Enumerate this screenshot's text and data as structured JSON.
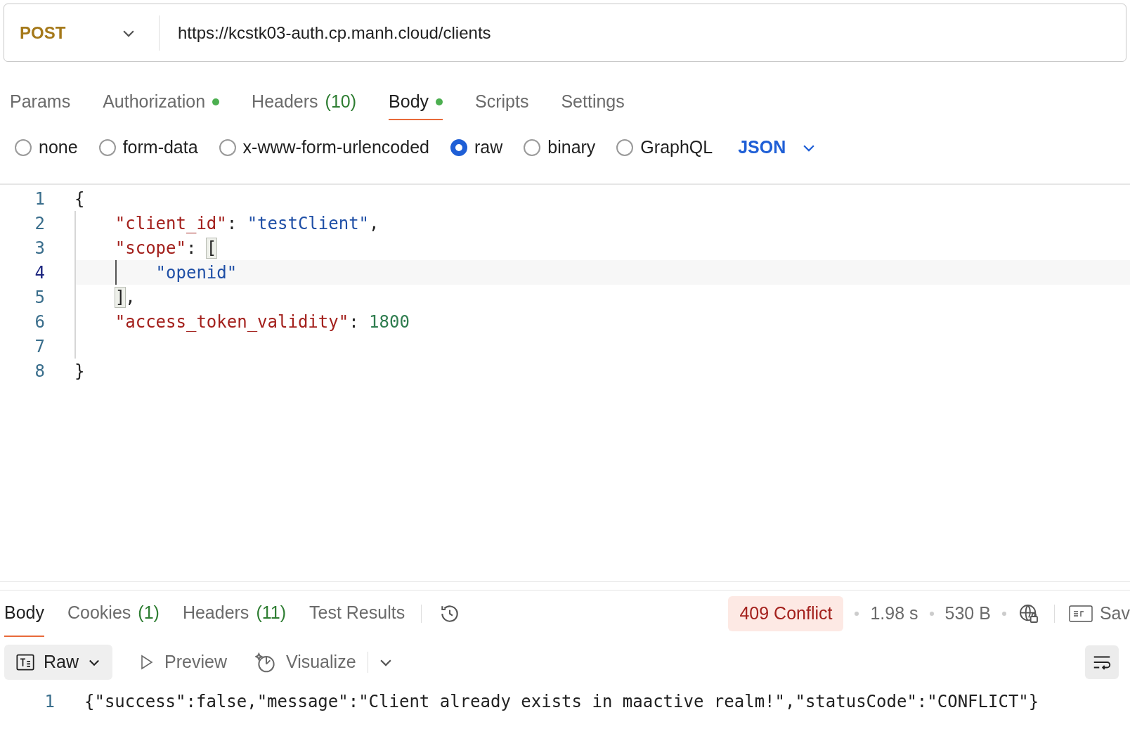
{
  "request": {
    "method": "POST",
    "url": "https://kcstk03-auth.cp.manh.cloud/clients"
  },
  "request_tabs": [
    {
      "label": "Params",
      "selected": false,
      "dot": false
    },
    {
      "label": "Authorization",
      "selected": false,
      "dot": true
    },
    {
      "label": "Headers",
      "count": "(10)",
      "selected": false,
      "dot": false
    },
    {
      "label": "Body",
      "selected": true,
      "dot": true
    },
    {
      "label": "Scripts",
      "selected": false,
      "dot": false
    },
    {
      "label": "Settings",
      "selected": false,
      "dot": false
    }
  ],
  "body_types": [
    {
      "label": "none",
      "selected": false
    },
    {
      "label": "form-data",
      "selected": false
    },
    {
      "label": "x-www-form-urlencoded",
      "selected": false
    },
    {
      "label": "raw",
      "selected": true
    },
    {
      "label": "binary",
      "selected": false
    },
    {
      "label": "GraphQL",
      "selected": false
    }
  ],
  "body_format": "JSON",
  "editor": {
    "lines": [
      {
        "number": "1",
        "active": false,
        "tokens": [
          {
            "kind": "punct",
            "text": "{"
          }
        ]
      },
      {
        "number": "2",
        "active": false,
        "tokens": [
          {
            "kind": "key",
            "text": "    \"client_id\""
          },
          {
            "kind": "punct",
            "text": ": "
          },
          {
            "kind": "string",
            "text": "\"testClient\""
          },
          {
            "kind": "punct",
            "text": ","
          }
        ]
      },
      {
        "number": "3",
        "active": false,
        "tokens": [
          {
            "kind": "key",
            "text": "    \"scope\""
          },
          {
            "kind": "punct",
            "text": ": "
          },
          {
            "kind": "bracket",
            "text": "["
          }
        ]
      },
      {
        "number": "4",
        "active": true,
        "tokens": [
          {
            "kind": "string",
            "text": "        \"openid\""
          }
        ]
      },
      {
        "number": "5",
        "active": false,
        "tokens": [
          {
            "kind": "bracket",
            "text": "    ]"
          },
          {
            "kind": "punct",
            "text": ","
          }
        ]
      },
      {
        "number": "6",
        "active": false,
        "tokens": [
          {
            "kind": "key",
            "text": "    \"access_token_validity\""
          },
          {
            "kind": "punct",
            "text": ": "
          },
          {
            "kind": "number",
            "text": "1800"
          }
        ]
      },
      {
        "number": "7",
        "active": false
      },
      {
        "number": "8",
        "active": false,
        "tokens": [
          {
            "kind": "punct",
            "text": "}"
          }
        ]
      }
    ]
  },
  "response_tabs": [
    {
      "label": "Body",
      "selected": true
    },
    {
      "label": "Cookies",
      "count": "(1)",
      "selected": false
    },
    {
      "label": "Headers",
      "count": "(11)",
      "selected": false
    },
    {
      "label": "Test Results",
      "selected": false
    }
  ],
  "response_status": {
    "status": "409 Conflict",
    "time": "1.98 s",
    "size": "530 B",
    "save_label": "Sav"
  },
  "response_views": {
    "format": "Raw",
    "preview": "Preview",
    "visualize": "Visualize"
  },
  "response_body": {
    "lines": [
      {
        "number": "1",
        "text": "{\"success\":false,\"message\":\"Client already exists in maactive realm!\",\"statusCode\":\"CONFLICT\"}"
      }
    ]
  }
}
